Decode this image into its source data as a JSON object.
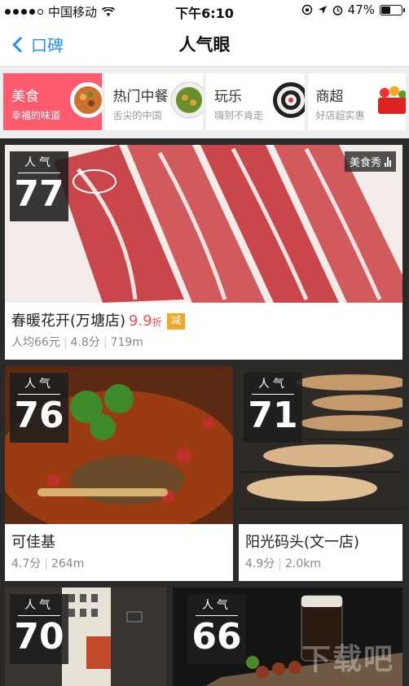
{
  "status": {
    "carrier": "中国移动",
    "time": "下午6:10",
    "battery": "47%",
    "battery_level": 0.47
  },
  "nav": {
    "back_label": "口碑",
    "title": "人气眼"
  },
  "categories": [
    {
      "name": "美食",
      "sub": "幸福的味道",
      "active": true
    },
    {
      "name": "热门中餐",
      "sub": "舌尖的中国",
      "active": false
    },
    {
      "name": "玩乐",
      "sub": "嗨到不肯走",
      "active": false
    },
    {
      "name": "商超",
      "sub": "好店超实惠",
      "active": false
    }
  ],
  "cards": [
    {
      "badge_label": "人气",
      "score": "77",
      "name": "春暖花开(万塘店)",
      "discount": "9.9",
      "discount_unit": "折",
      "promo": "减",
      "tag": "美食秀",
      "meta": [
        "人均66元",
        "4.8分",
        "719m"
      ]
    },
    {
      "badge_label": "人气",
      "score": "76",
      "name": "可佳基",
      "meta": [
        "4.7分",
        "264m"
      ]
    },
    {
      "badge_label": "人气",
      "score": "71",
      "name": "阳光码头(文一店)",
      "meta": [
        "4.9分",
        "2.0km"
      ]
    },
    {
      "badge_label": "人气",
      "score": "70"
    },
    {
      "badge_label": "人气",
      "score": "66"
    }
  ],
  "watermark": "下载吧"
}
